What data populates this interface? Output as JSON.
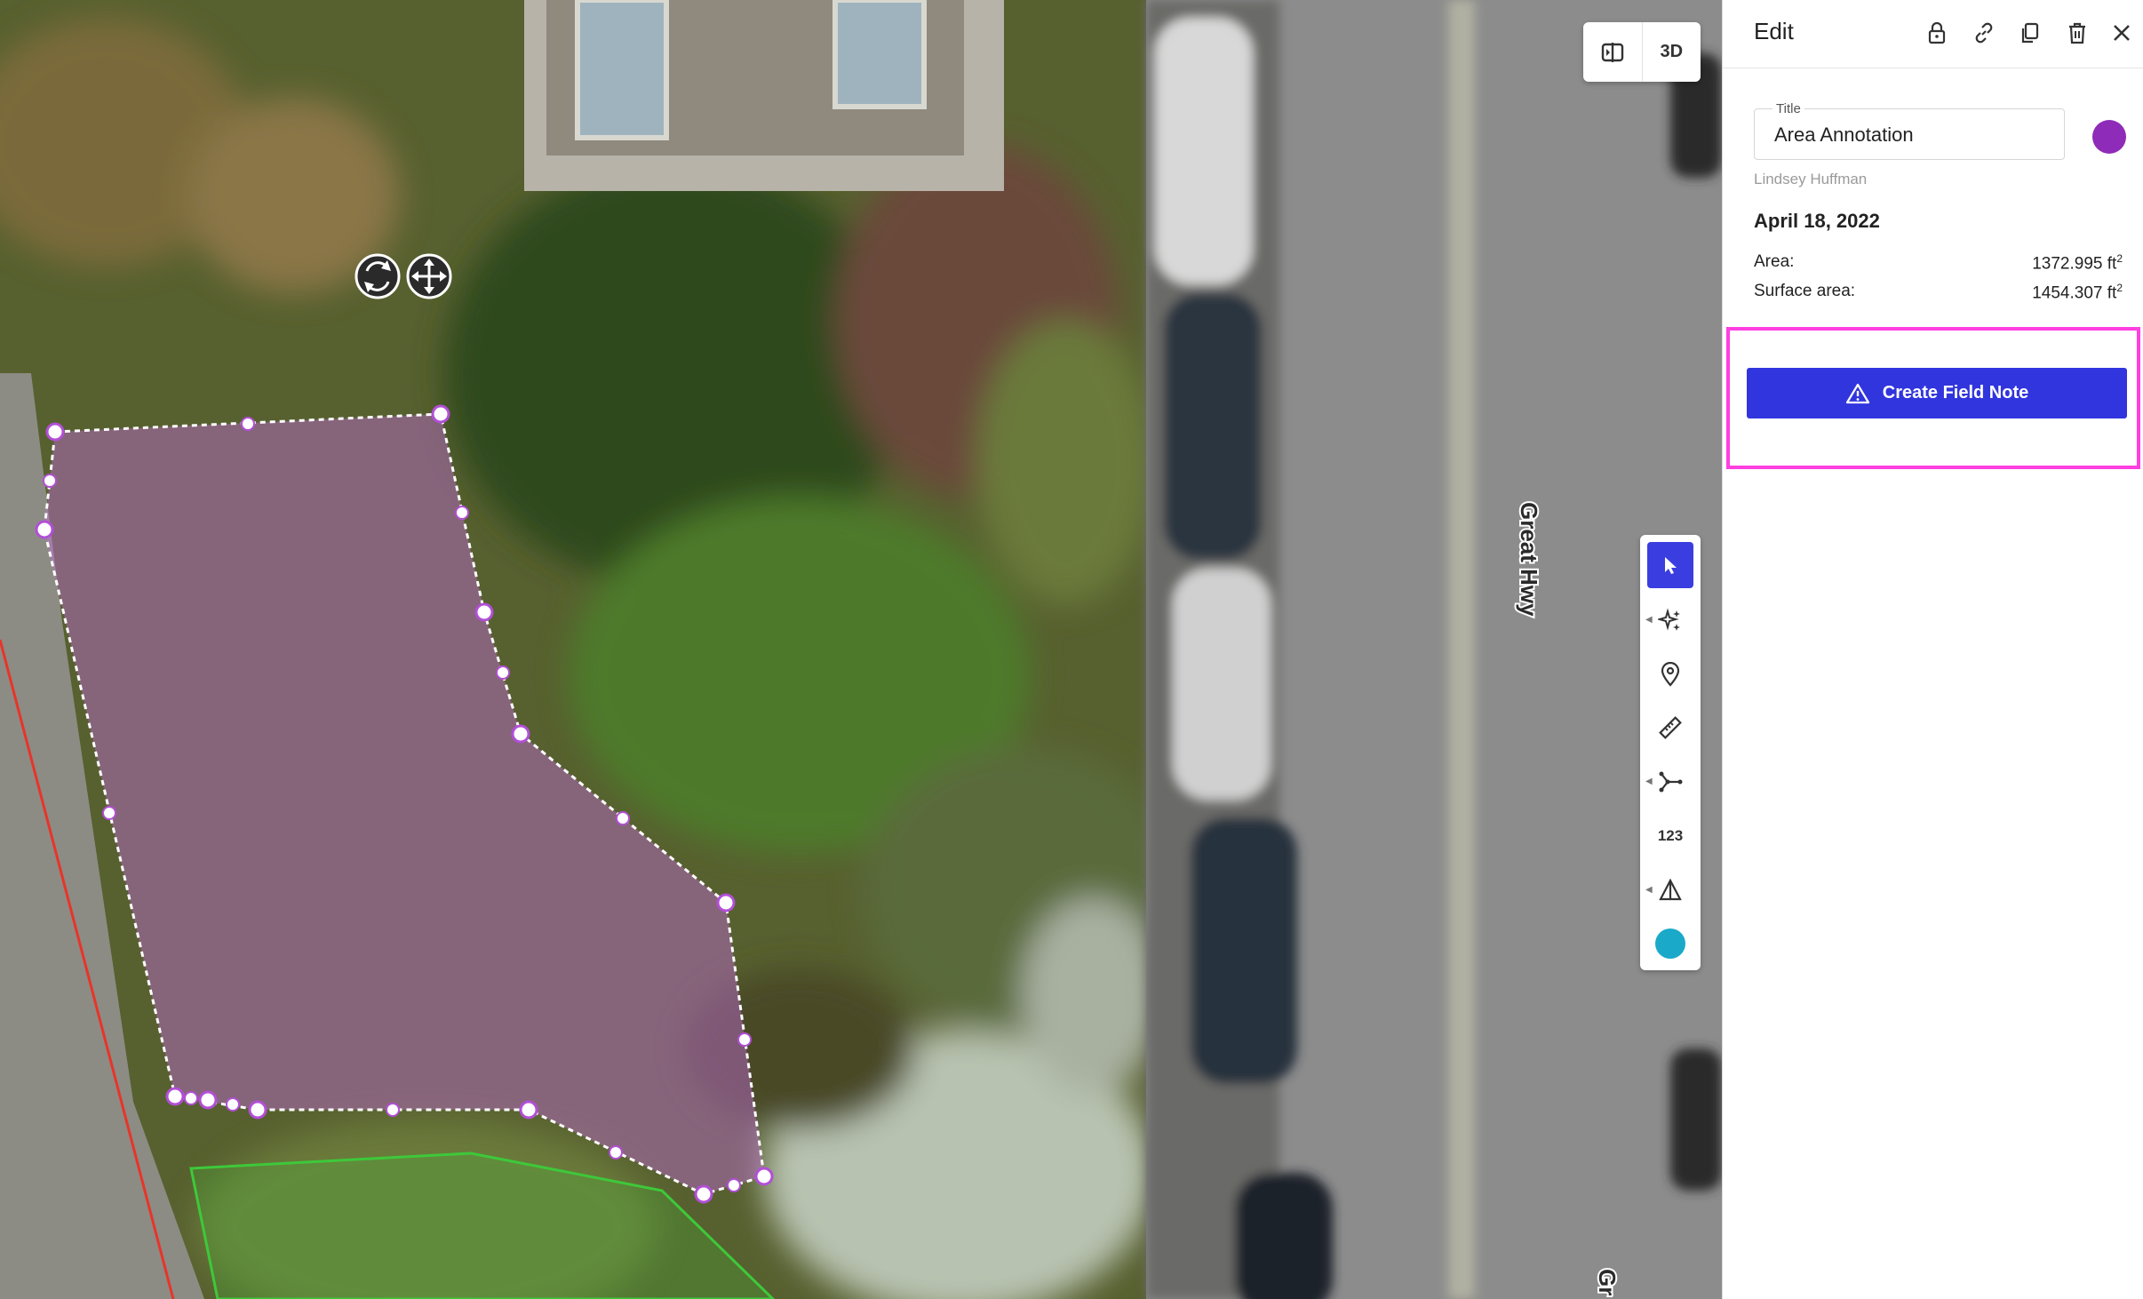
{
  "map": {
    "road_label": "Great Hwy",
    "road_label_partial": "Gr",
    "view_toggle": {
      "split_icon": "split-view-icon",
      "mode_label": "3D"
    },
    "toolbar": {
      "tools": [
        {
          "name": "select",
          "icon": "cursor-arrow-icon",
          "active": true
        },
        {
          "name": "magic",
          "icon": "sparkle-icon",
          "active": false
        },
        {
          "name": "pin",
          "icon": "location-pin-icon",
          "active": false
        },
        {
          "name": "measure",
          "icon": "ruler-icon",
          "active": false
        },
        {
          "name": "polyline",
          "icon": "vector-path-icon",
          "active": false
        },
        {
          "name": "count",
          "label": "123",
          "active": false
        },
        {
          "name": "volume",
          "icon": "triangle-shape-icon",
          "active": false
        },
        {
          "name": "color",
          "icon": "color-dot-icon",
          "active": false
        }
      ],
      "active_color": "#3a3ee0",
      "color_dot": "#1aa9c9"
    },
    "annotation_colors": {
      "area_fill": "#c16ad8",
      "area_stroke": "#ffffff",
      "second_area": "#3ec83a",
      "boundary_line": "#e8342a"
    }
  },
  "panel": {
    "title": "Edit",
    "header_icons": [
      "lock-icon",
      "link-icon",
      "copy-icon",
      "trash-icon",
      "close-icon"
    ],
    "title_field": {
      "label": "Title",
      "value": "Area Annotation"
    },
    "annotation_color": "#8e2bb8",
    "author": "Lindsey Huffman",
    "date": "April 18, 2022",
    "metrics": [
      {
        "label": "Area:",
        "value": "1372.995 ft",
        "unit_sup": "2"
      },
      {
        "label": "Surface area:",
        "value": "1454.307 ft",
        "unit_sup": "2"
      }
    ],
    "create_button": {
      "label": "Create Field Note",
      "icon": "warning-triangle-icon",
      "color": "#3135dd"
    },
    "highlight_color": "#ff3fe0"
  }
}
